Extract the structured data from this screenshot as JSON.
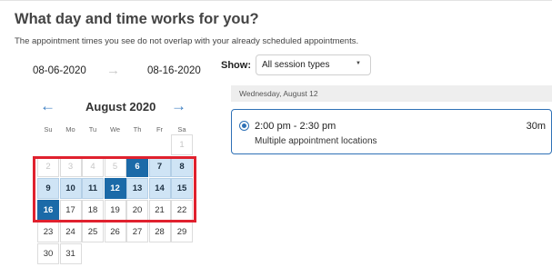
{
  "header": {
    "title": "What day and time works for you?",
    "subtitle": "The appointment times you see do not overlap with your already scheduled appointments."
  },
  "date_range": {
    "start": "08-06-2020",
    "end": "08-16-2020"
  },
  "calendar": {
    "month": "August 2020",
    "prev_icon": "←",
    "next_icon": "→",
    "range_arrow_icon": "→",
    "weekdays": [
      "Su",
      "Mo",
      "Tu",
      "We",
      "Th",
      "Fr",
      "Sa"
    ],
    "weeks": [
      [
        null,
        null,
        null,
        null,
        null,
        null,
        {
          "day": "1",
          "state": "disabled"
        }
      ],
      [
        {
          "day": "2",
          "state": "disabled"
        },
        {
          "day": "3",
          "state": "disabled"
        },
        {
          "day": "4",
          "state": "disabled"
        },
        {
          "day": "5",
          "state": "disabled"
        },
        {
          "day": "6",
          "state": "range-start"
        },
        {
          "day": "7",
          "state": "available"
        },
        {
          "day": "8",
          "state": "available"
        }
      ],
      [
        {
          "day": "9",
          "state": "available"
        },
        {
          "day": "10",
          "state": "available"
        },
        {
          "day": "11",
          "state": "available"
        },
        {
          "day": "12",
          "state": "selected"
        },
        {
          "day": "13",
          "state": "available"
        },
        {
          "day": "14",
          "state": "available"
        },
        {
          "day": "15",
          "state": "available"
        }
      ],
      [
        {
          "day": "16",
          "state": "range-end"
        },
        {
          "day": "17",
          "state": "normal"
        },
        {
          "day": "18",
          "state": "normal"
        },
        {
          "day": "19",
          "state": "normal"
        },
        {
          "day": "20",
          "state": "normal"
        },
        {
          "day": "21",
          "state": "normal"
        },
        {
          "day": "22",
          "state": "normal"
        }
      ],
      [
        {
          "day": "23",
          "state": "normal"
        },
        {
          "day": "24",
          "state": "normal"
        },
        {
          "day": "25",
          "state": "normal"
        },
        {
          "day": "26",
          "state": "normal"
        },
        {
          "day": "27",
          "state": "normal"
        },
        {
          "day": "28",
          "state": "normal"
        },
        {
          "day": "29",
          "state": "normal"
        }
      ],
      [
        {
          "day": "30",
          "state": "normal"
        },
        {
          "day": "31",
          "state": "normal"
        },
        null,
        null,
        null,
        null,
        null
      ]
    ]
  },
  "filter": {
    "label": "Show:",
    "selected": "All session types",
    "caret_icon": "▼"
  },
  "schedule": {
    "day_header": "Wednesday, August 12",
    "slot": {
      "time": "2:00 pm - 2:30 pm",
      "location": "Multiple appointment locations",
      "duration": "30m"
    }
  },
  "colors": {
    "accent": "#1b6aa8",
    "available": "#cfe4f5",
    "highlight": "#e0212e",
    "slot_border": "#2f71b6"
  }
}
